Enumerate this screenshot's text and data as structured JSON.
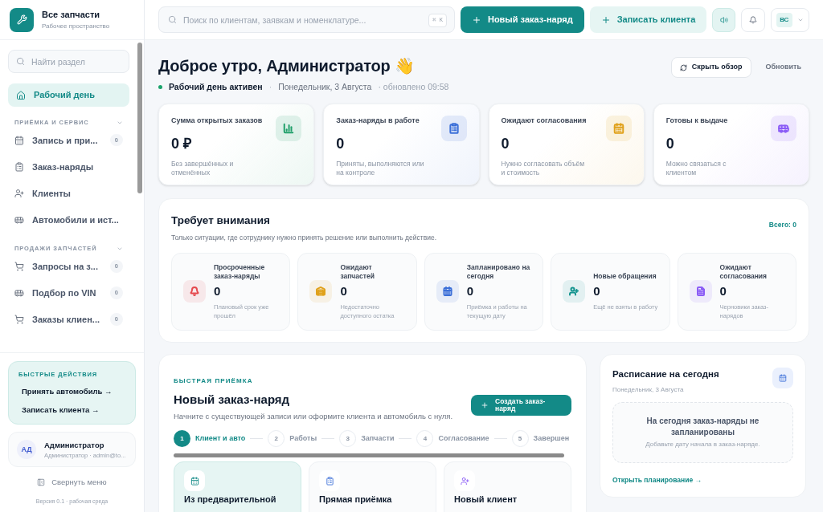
{
  "brand": {
    "name": "Все запчасти",
    "subtitle": "Рабочее пространство"
  },
  "sidebar": {
    "search": {
      "placeholder": "Найти раздел"
    },
    "home": {
      "label": "Рабочий день",
      "selected": true
    },
    "sections": [
      {
        "title": "ПРИЁМКА И СЕРВИС",
        "expanded": true,
        "items": [
          {
            "label": "Запись и при...",
            "badge": "0",
            "selected": false
          },
          {
            "label": "Заказ-наряды",
            "selected": false
          },
          {
            "label": "Клиенты",
            "selected": false
          },
          {
            "label": "Автомобили и ист...",
            "selected": false
          }
        ]
      },
      {
        "title": "ПРОДАЖИ ЗАПЧАСТЕЙ",
        "expanded": true,
        "items": [
          {
            "label": "Запросы на з...",
            "badge": "0",
            "selected": false
          },
          {
            "label": "Подбор по VIN",
            "badge": "0",
            "selected": false
          },
          {
            "label": "Заказы клиен...",
            "badge": "0",
            "selected": false
          }
        ]
      }
    ],
    "quick_actions": {
      "title": "БЫСТРЫЕ ДЕЙСТВИЯ",
      "links": [
        "Принять автомобиль →",
        "Записать клиента →"
      ]
    },
    "user": {
      "initials": "АД",
      "name": "Администратор",
      "detail": "Администратор · admin@to..."
    },
    "collapse": "Свернуть меню",
    "version": "Версия 0.1 · рабочая среда"
  },
  "header": {
    "search": {
      "placeholder": "Поиск по клиентам, заявкам и номенклатуре...",
      "shortcut": "⌘ K"
    },
    "primary_button": "Новый заказ-наряд",
    "secondary_button": "Записать клиента",
    "avatar": "ВС"
  },
  "greeting": {
    "title": "Доброе утро, Администратор 👋",
    "status": "Рабочий день активен",
    "active": true,
    "separator": "·",
    "date": "Понедельник, 3 Августа",
    "updated": "· обновлено 09:58",
    "hide_button": "Скрыть обзор",
    "refresh_button": "Обновить"
  },
  "stats": [
    {
      "title": "Сумма открытых заказов",
      "value": "0 ₽",
      "note": "Без завершённых и отменённых",
      "color": "#22a06b"
    },
    {
      "title": "Заказ-наряды в работе",
      "value": "0",
      "note": "Приняты, выполняются или на контроле",
      "color": "#3b6fd8"
    },
    {
      "title": "Ожидают согласования",
      "value": "0",
      "note": "Нужно согласовать объём и стоимость",
      "color": "#e0a11b"
    },
    {
      "title": "Готовы к выдаче",
      "value": "0",
      "note": "Можно связаться с клиентом",
      "color": "#8b5cf6"
    }
  ],
  "attention": {
    "title": "Требует внимания",
    "subtitle": "Только ситуации, где сотруднику нужно принять решение или выполнить действие.",
    "total": "Всего: 0",
    "items": [
      {
        "title": "Просроченные заказ-наряды",
        "value": "0",
        "note": "Плановый срок уже прошёл",
        "color": "#e5484d"
      },
      {
        "title": "Ожидают запчастей",
        "value": "0",
        "note": "Недостаточно доступного остатка",
        "color": "#e0a11b"
      },
      {
        "title": "Запланировано на сегодня",
        "value": "0",
        "note": "Приёмка и работы на текущую дату",
        "color": "#3b6fd8"
      },
      {
        "title": "Новые обращения",
        "value": "0",
        "note": "Ещё не взяты в работу",
        "color": "#14948f"
      },
      {
        "title": "Ожидают согласования",
        "value": "0",
        "note": "Черновики заказ-нарядов",
        "color": "#8b5cf6"
      }
    ]
  },
  "intake": {
    "eyebrow": "БЫСТРАЯ ПРИЁМКА",
    "title": "Новый заказ-наряд",
    "description": "Начните с существующей записи или оформите клиента и автомобиль с нуля.",
    "button": "Создать заказ-наряд",
    "steps": [
      {
        "number": "1",
        "label": "Клиент и авто",
        "selected": true
      },
      {
        "number": "2",
        "label": "Работы",
        "selected": false
      },
      {
        "number": "3",
        "label": "Запчасти",
        "selected": false
      },
      {
        "number": "4",
        "label": "Согласование",
        "selected": false
      },
      {
        "number": "5",
        "label": "Завершен",
        "selected": false
      }
    ],
    "options": [
      {
        "title": "Из предварительной",
        "selected": true
      },
      {
        "title": "Прямая приёмка",
        "selected": false
      },
      {
        "title": "Новый клиент",
        "selected": false
      }
    ]
  },
  "schedule": {
    "title": "Расписание на сегодня",
    "date": "Понедельник, 3 Августа",
    "empty_title": "На сегодня заказ-наряды не запланированы",
    "empty_hint": "Добавьте дату начала в заказ-наряде.",
    "link": "Открыть планирование →"
  }
}
